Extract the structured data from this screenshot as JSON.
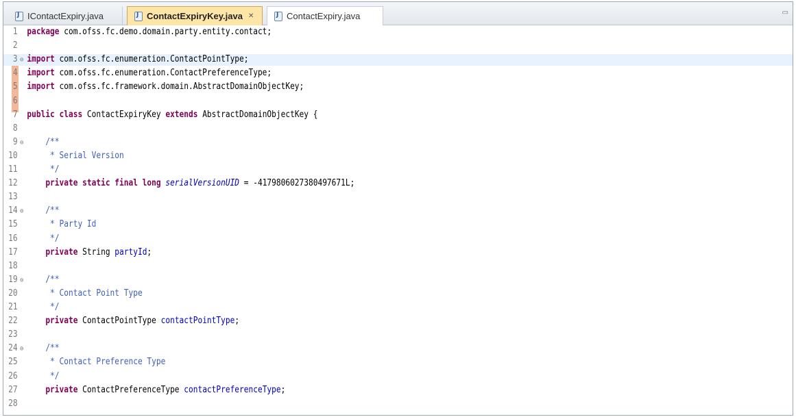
{
  "tabs": [
    {
      "label": "IContactExpiry.java"
    },
    {
      "label": "ContactExpiryKey.java",
      "close": "✕",
      "active": true
    },
    {
      "label": "ContactExpiry.java"
    }
  ],
  "lines": [
    {
      "n": "1",
      "fold": "",
      "parts": [
        [
          "kw",
          "package"
        ],
        [
          "",
          ""
        ],
        [
          "",
          " com.ofss.fc.demo.domain.party.entity.contact;"
        ]
      ]
    },
    {
      "n": "2",
      "fold": "",
      "parts": []
    },
    {
      "n": "3",
      "fold": "⊖",
      "parts": [
        [
          "kw",
          "import"
        ],
        [
          "",
          " com.ofss.fc.enumeration.ContactPointType;"
        ]
      ]
    },
    {
      "n": "4",
      "fold": "",
      "parts": [
        [
          "kw",
          "import"
        ],
        [
          "",
          " com.ofss.fc.enumeration.ContactPreferenceType;"
        ]
      ]
    },
    {
      "n": "5",
      "fold": "",
      "parts": [
        [
          "kw",
          "import"
        ],
        [
          "",
          " com.ofss.fc.framework.domain.AbstractDomainObjectKey;"
        ]
      ]
    },
    {
      "n": "6",
      "fold": "",
      "parts": []
    },
    {
      "n": "7",
      "fold": "",
      "parts": [
        [
          "kw",
          "public class"
        ],
        [
          "",
          " ContactExpiryKey "
        ],
        [
          "kw",
          "extends"
        ],
        [
          "",
          " AbstractDomainObjectKey {"
        ]
      ]
    },
    {
      "n": "8",
      "fold": "",
      "parts": []
    },
    {
      "n": "9",
      "fold": "⊖",
      "parts": [
        [
          "cm",
          "    /**"
        ]
      ]
    },
    {
      "n": "10",
      "fold": "",
      "parts": [
        [
          "cm",
          "     * Serial Version"
        ]
      ]
    },
    {
      "n": "11",
      "fold": "",
      "parts": [
        [
          "cm",
          "     */"
        ]
      ]
    },
    {
      "n": "12",
      "fold": "",
      "parts": [
        [
          "",
          "    "
        ],
        [
          "kw",
          "private static final long"
        ],
        [
          "",
          " "
        ],
        [
          "sfld",
          "serialVersionUID"
        ],
        [
          "",
          " = -4179806027380497671L;"
        ]
      ]
    },
    {
      "n": "13",
      "fold": "",
      "parts": []
    },
    {
      "n": "14",
      "fold": "⊖",
      "parts": [
        [
          "cm",
          "    /**"
        ]
      ]
    },
    {
      "n": "15",
      "fold": "",
      "parts": [
        [
          "cm",
          "     * Party Id"
        ]
      ]
    },
    {
      "n": "16",
      "fold": "",
      "parts": [
        [
          "cm",
          "     */"
        ]
      ]
    },
    {
      "n": "17",
      "fold": "",
      "parts": [
        [
          "",
          "    "
        ],
        [
          "kw",
          "private"
        ],
        [
          "",
          " String "
        ],
        [
          "fld",
          "partyId"
        ],
        [
          "",
          ";"
        ]
      ]
    },
    {
      "n": "18",
      "fold": "",
      "parts": []
    },
    {
      "n": "19",
      "fold": "⊖",
      "parts": [
        [
          "cm",
          "    /**"
        ]
      ]
    },
    {
      "n": "20",
      "fold": "",
      "parts": [
        [
          "cm",
          "     * Contact Point Type"
        ]
      ]
    },
    {
      "n": "21",
      "fold": "",
      "parts": [
        [
          "cm",
          "     */"
        ]
      ]
    },
    {
      "n": "22",
      "fold": "",
      "parts": [
        [
          "",
          "    "
        ],
        [
          "kw",
          "private"
        ],
        [
          "",
          " ContactPointType "
        ],
        [
          "fld",
          "contactPointType"
        ],
        [
          "",
          ";"
        ]
      ]
    },
    {
      "n": "23",
      "fold": "",
      "parts": []
    },
    {
      "n": "24",
      "fold": "⊖",
      "parts": [
        [
          "cm",
          "    /**"
        ]
      ]
    },
    {
      "n": "25",
      "fold": "",
      "parts": [
        [
          "cm",
          "     * Contact Preference Type"
        ]
      ]
    },
    {
      "n": "26",
      "fold": "",
      "parts": [
        [
          "cm",
          "     */"
        ]
      ]
    },
    {
      "n": "27",
      "fold": "",
      "parts": [
        [
          "",
          "    "
        ],
        [
          "kw",
          "private"
        ],
        [
          "",
          " ContactPreferenceType "
        ],
        [
          "fld",
          "contactPreferenceType"
        ],
        [
          "",
          ";"
        ]
      ]
    },
    {
      "n": "28",
      "fold": "",
      "parts": []
    }
  ]
}
